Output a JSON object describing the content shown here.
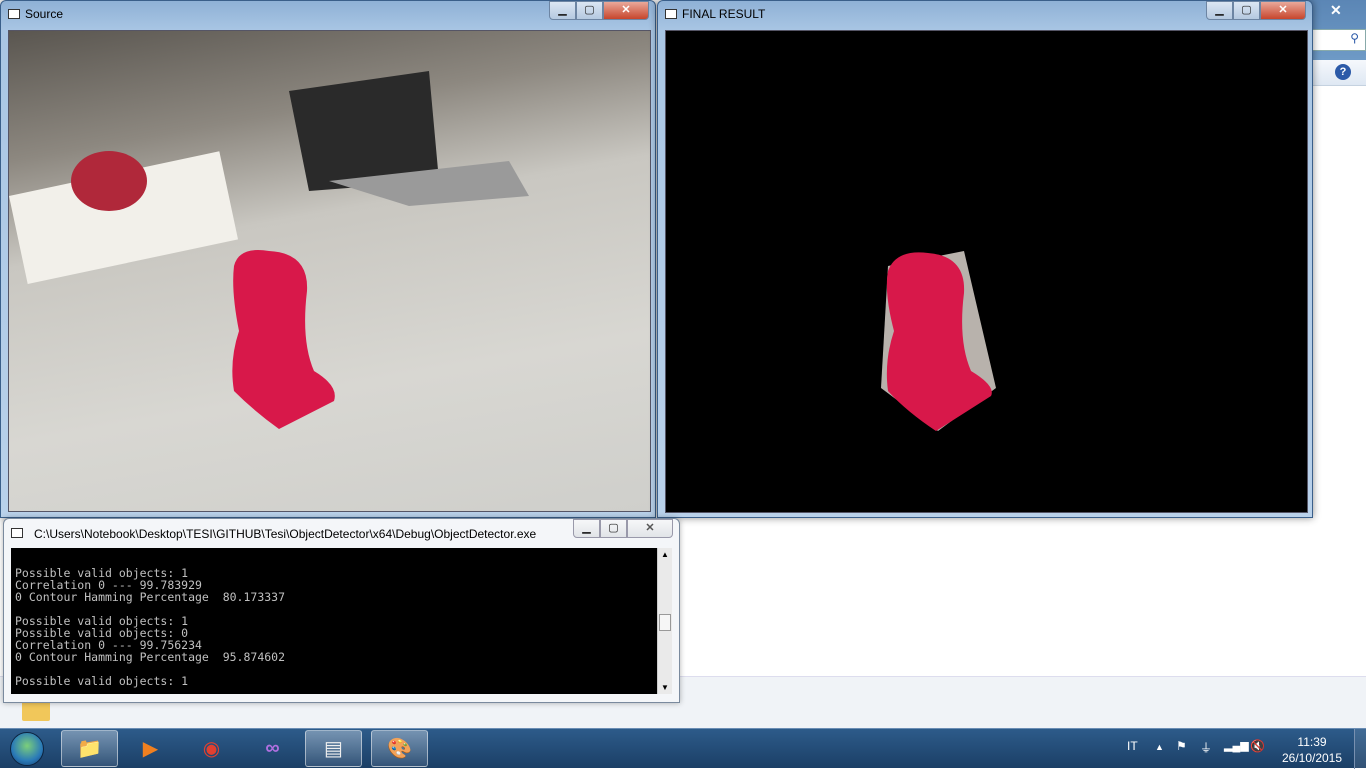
{
  "windows": {
    "source": {
      "title": "Source"
    },
    "final": {
      "title": "FINAL RESULT"
    },
    "console": {
      "title": "C:\\Users\\Notebook\\Desktop\\TESI\\GITHUB\\Tesi\\ObjectDetector\\x64\\Debug\\ObjectDetector.exe",
      "lines": [
        "",
        "Possible valid objects: 1",
        "Correlation 0 --- 99.783929",
        "0 Contour Hamming Percentage  80.173337",
        "",
        "Possible valid objects: 1",
        "Possible valid objects: 0",
        "Correlation 0 --- 99.756234",
        "0 Contour Hamming Percentage  95.874602",
        "",
        "Possible valid objects: 1"
      ]
    },
    "controls": {
      "minimize": "▁",
      "maximize": "▢",
      "close": "✕"
    }
  },
  "background": {
    "help": "?",
    "close": "✕"
  },
  "taskbar": {
    "items": [
      {
        "name": "windows-explorer",
        "icon": "📁",
        "active": true
      },
      {
        "name": "media-player",
        "icon": "▶",
        "active": false
      },
      {
        "name": "chrome",
        "icon": "◉",
        "active": false
      },
      {
        "name": "visual-studio",
        "icon": "∞",
        "active": false
      },
      {
        "name": "console",
        "icon": "▤",
        "active": true
      },
      {
        "name": "paint",
        "icon": "🎨",
        "active": true
      }
    ],
    "language": "IT",
    "time": "11:39",
    "date": "26/10/2015"
  }
}
